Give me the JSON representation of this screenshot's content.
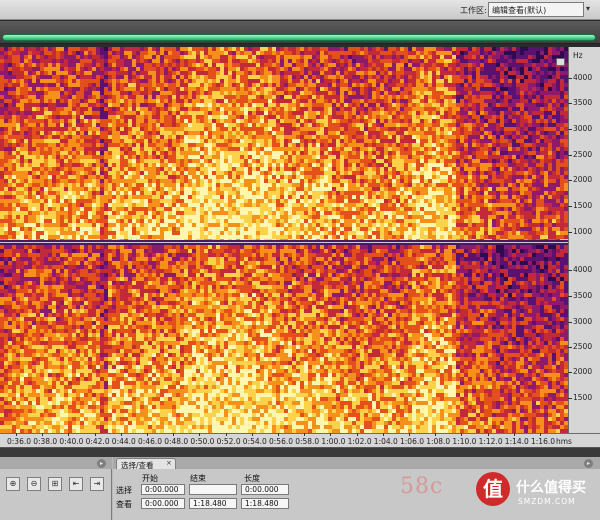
{
  "workspace": {
    "label": "工作区:",
    "selected": "编辑查看(默认)"
  },
  "spectrogram": {
    "channels": 2,
    "colormap": [
      "#2e0b4e",
      "#5a1170",
      "#8d1a6b",
      "#c22a3a",
      "#e3501c",
      "#f5901a",
      "#fbd24a",
      "#fff6b0"
    ],
    "divider_color": "#d0c8d8"
  },
  "frequency_ruler": {
    "unit": "Hz",
    "channel1_labels": [
      "4000",
      "3500",
      "3000",
      "2500",
      "2000",
      "1500",
      "1000"
    ],
    "channel2_labels": [
      "4000",
      "3500",
      "3000",
      "2500",
      "2000",
      "1500"
    ]
  },
  "time_ruler": {
    "unit": "hms",
    "labels": [
      "0:36.0",
      "0:38.0",
      "0:40.0",
      "0:42.0",
      "0:44.0",
      "0:46.0",
      "0:48.0",
      "0:50.0",
      "0:52.0",
      "0:54.0",
      "0:56.0",
      "0:58.0",
      "1:00.0",
      "1:02.0",
      "1:04.0",
      "1:06.0",
      "1:08.0",
      "1:10.0",
      "1:12.0",
      "1:14.0",
      "1:16.0"
    ]
  },
  "zoom_panel": {
    "buttons": [
      {
        "icon": "zoom-in-amplitude-icon",
        "glyph": "⊕"
      },
      {
        "icon": "zoom-out-amplitude-icon",
        "glyph": "⊖"
      },
      {
        "icon": "zoom-in-frequency-icon",
        "glyph": "⊞"
      },
      {
        "icon": "zoom-fit-icon",
        "glyph": "⇤"
      },
      {
        "icon": "zoom-full-icon",
        "glyph": "⇥"
      }
    ]
  },
  "selection_panel": {
    "tab_label": "选择/查看",
    "tab_close": "×",
    "columns": {
      "start": "开始",
      "end": "结束",
      "length": "长度"
    },
    "rows": {
      "selection": {
        "label": "选择",
        "start": "0:00.000",
        "end": "",
        "length": "0:00.000"
      },
      "view": {
        "label": "查看",
        "start": "0:00.000",
        "end": "1:18.480",
        "length": "1:18.480"
      }
    }
  },
  "watermark": {
    "text_58": "58c",
    "logo_glyph": "值",
    "brand_text": "什么值得买",
    "domain": "SMZDM.COM"
  }
}
